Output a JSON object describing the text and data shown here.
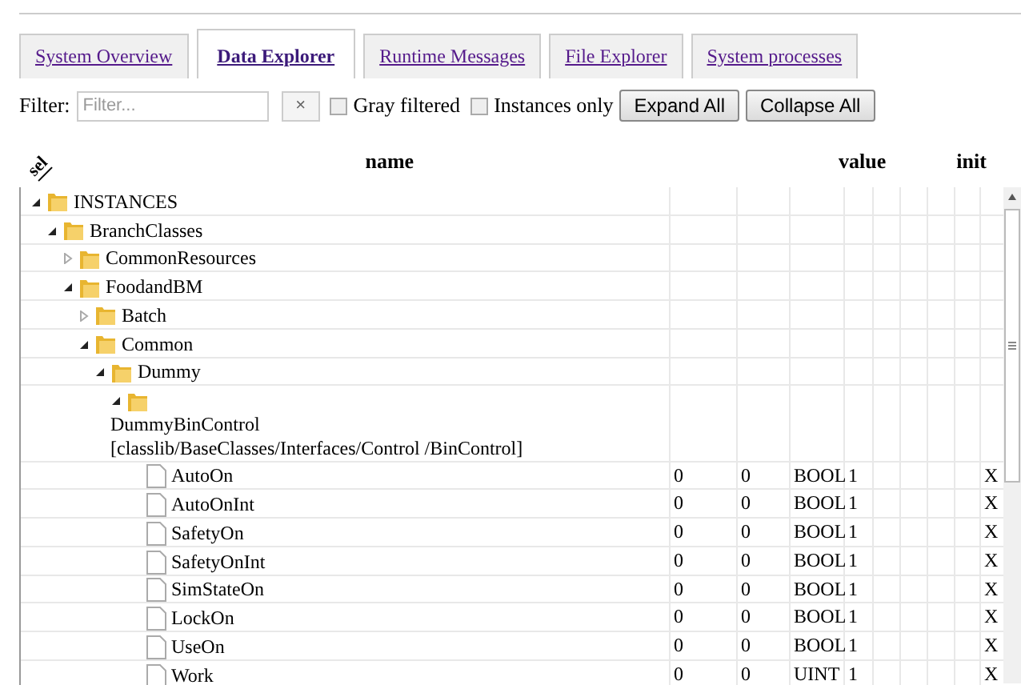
{
  "tabs": [
    {
      "label": "System Overview",
      "selected": false
    },
    {
      "label": "Data Explorer",
      "selected": true
    },
    {
      "label": "Runtime Messages",
      "selected": false
    },
    {
      "label": "File Explorer",
      "selected": false
    },
    {
      "label": "System processes",
      "selected": false
    }
  ],
  "filter": {
    "label": "Filter:",
    "placeholder": "Filter...",
    "clear": "×",
    "gray_filtered": {
      "label": "Gray filtered",
      "checked": false
    },
    "instances_only": {
      "label": "Instances only",
      "checked": false
    },
    "buttons": [
      "Expand All",
      "Collapse All"
    ]
  },
  "columns": {
    "sel": "sel",
    "name": "name",
    "value": "value",
    "init": "init"
  },
  "tree": [
    {
      "name": "INSTANCES",
      "expanded": true,
      "children": [
        {
          "name": "BranchClasses",
          "expanded": true,
          "children": [
            {
              "name": "CommonResources",
              "expanded": false
            },
            {
              "name": "FoodandBM",
              "expanded": true,
              "children": [
                {
                  "name": "Batch",
                  "expanded": false
                },
                {
                  "name": "Common",
                  "expanded": true,
                  "children": [
                    {
                      "name": "Dummy",
                      "expanded": true,
                      "children": [
                        {
                          "name": "DummyBinControl [classlib/BaseClasses/Interfaces/Control /BinControl]",
                          "expanded": true,
                          "children": [
                            {
                              "kind": "variable",
                              "name": "AutoOn",
                              "values": [
                                "0",
                                "0",
                                "BOOL",
                                "1"
                              ],
                              "init": "X"
                            },
                            {
                              "kind": "variable",
                              "name": "AutoOnInt",
                              "values": [
                                "0",
                                "0",
                                "BOOL",
                                "1"
                              ],
                              "init": "X"
                            },
                            {
                              "kind": "variable",
                              "name": "SafetyOn",
                              "values": [
                                "0",
                                "0",
                                "BOOL",
                                "1"
                              ],
                              "init": "X"
                            },
                            {
                              "kind": "variable",
                              "name": "SafetyOnInt",
                              "values": [
                                "0",
                                "0",
                                "BOOL",
                                "1"
                              ],
                              "init": "X"
                            },
                            {
                              "kind": "variable",
                              "name": "SimStateOn",
                              "values": [
                                "0",
                                "0",
                                "BOOL",
                                "1"
                              ],
                              "init": "X"
                            },
                            {
                              "kind": "variable",
                              "name": "LockOn",
                              "values": [
                                "0",
                                "0",
                                "BOOL",
                                "1"
                              ],
                              "init": "X"
                            },
                            {
                              "kind": "variable",
                              "name": "UseOn",
                              "values": [
                                "0",
                                "0",
                                "BOOL",
                                "1"
                              ],
                              "init": "X"
                            },
                            {
                              "kind": "variable",
                              "name": "Work",
                              "values": [
                                "0",
                                "0",
                                "UINT",
                                "1"
                              ],
                              "init": "X"
                            }
                          ]
                        }
                      ]
                    }
                  ]
                }
              ]
            }
          ]
        }
      ]
    }
  ]
}
